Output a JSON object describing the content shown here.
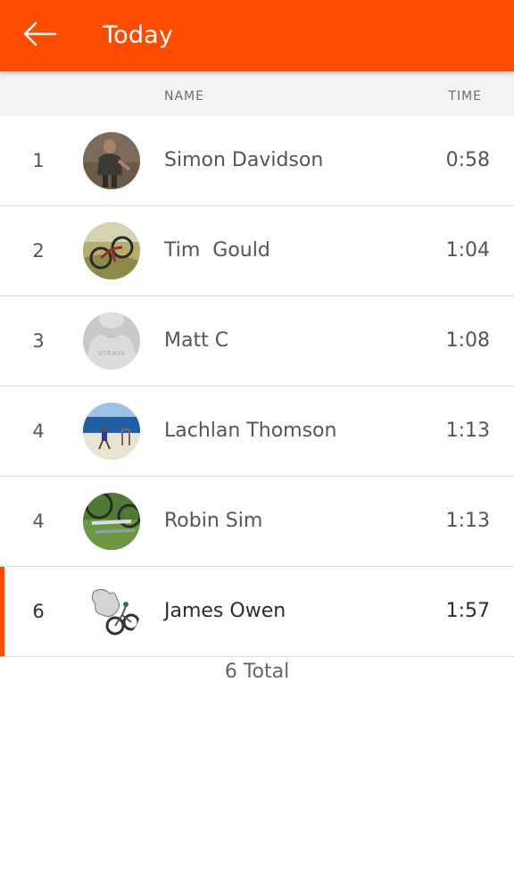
{
  "header": {
    "title": "Today",
    "back_icon": "arrow-left-icon",
    "color": "#fc4c02"
  },
  "columns": {
    "name": "NAME",
    "time": "TIME"
  },
  "rows": [
    {
      "rank": "1",
      "name": "Simon Davidson",
      "time": "0:58",
      "avatar": "photo-rider-avatar"
    },
    {
      "rank": "2",
      "name": "Tim  Gould",
      "time": "1:04",
      "avatar": "photo-bike-avatar"
    },
    {
      "rank": "3",
      "name": "Matt C",
      "time": "1:08",
      "avatar": "default-strava-avatar",
      "avatar_text": "STRAVA"
    },
    {
      "rank": "4",
      "name": "Lachlan Thomson",
      "time": "1:13",
      "avatar": "photo-beach-run-avatar"
    },
    {
      "rank": "4",
      "name": "Robin Sim",
      "time": "1:13",
      "avatar": "photo-bike-grass-avatar"
    },
    {
      "rank": "6",
      "name": "James Owen",
      "time": "1:57",
      "avatar": "sketch-bike-avatar",
      "highlighted": true
    }
  ],
  "footer": {
    "total": "6 Total"
  }
}
